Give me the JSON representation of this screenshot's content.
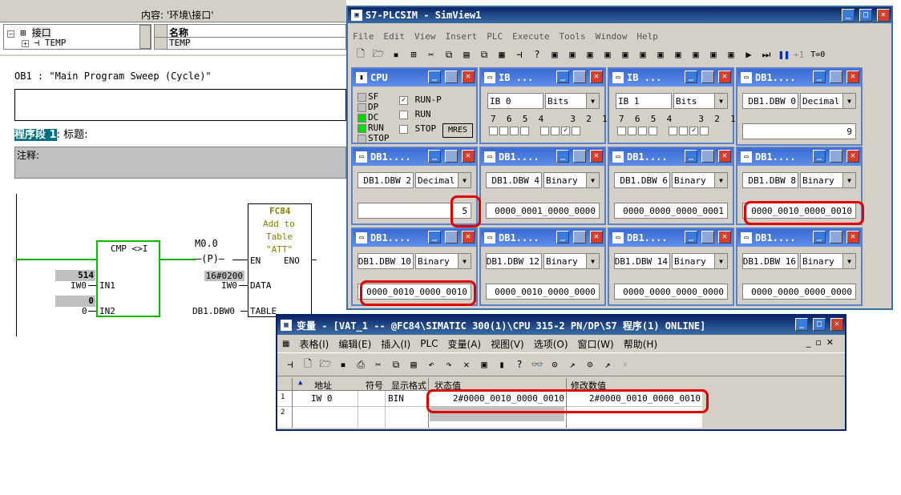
{
  "lad": {
    "content_label": "内容: '环境\\接口'",
    "tree_root": "接口",
    "tree_child": "TEMP",
    "name_header": "名称",
    "name_row": "TEMP",
    "block_title": "OB1 :  \"Main Program Sweep (Cycle)\"",
    "network_label": "程序段 1",
    "network_title": ": 标题:",
    "comment_label": "注释:",
    "cmp_title": "CMP <>I",
    "in1_value": "514",
    "in1_addr": "IW0",
    "in1_pin": "IN1",
    "in2_value": "0",
    "in2_addr": "0",
    "in2_pin": "IN2",
    "coil_addr": "M0.0",
    "coil_label": "P",
    "fc_name": "FC84",
    "fc_desc1": "Add to",
    "fc_desc2": "Table",
    "fc_desc3": "\"ATT\"",
    "en": "EN",
    "eno": "ENO",
    "data_value": "16#0200",
    "data_addr": "IW0",
    "data_pin": "DATA",
    "table_addr": "DB1.DBW0",
    "table_pin": "TABLE"
  },
  "plcsim": {
    "title": "S7-PLCSIM - SimView1",
    "menu": [
      "File",
      "Edit",
      "View",
      "Insert",
      "PLC",
      "Execute",
      "Tools",
      "Window",
      "Help"
    ],
    "step_label": "+1",
    "t_label": "T=0",
    "cpu": {
      "title": "CPU",
      "leds": [
        "SF",
        "DP",
        "DC",
        "RUN",
        "STOP"
      ],
      "modes": [
        "RUN-P",
        "RUN",
        "STOP"
      ],
      "mres": "MRES",
      "led_on": [
        "DC",
        "RUN"
      ]
    },
    "ib0": {
      "title": "IB ...",
      "addr": "IB    0",
      "fmt": "Bits",
      "bits": "7  6  5  4     3  2  1  0"
    },
    "ib1": {
      "title": "IB ...",
      "addr": "IB    1",
      "fmt": "Bits",
      "bits": "7  6  5  4     3  2  1  0"
    },
    "db_title": "DB1....",
    "db0": {
      "addr": "DB1.DBW    0",
      "fmt": "Decimal",
      "value": "9"
    },
    "db2": {
      "addr": "DB1.DBW    2",
      "fmt": "Decimal",
      "value": "5"
    },
    "db4": {
      "addr": "DB1.DBW    4",
      "fmt": "Binary",
      "value": "0000_0001_0000_0000"
    },
    "db6": {
      "addr": "DB1.DBW    6",
      "fmt": "Binary",
      "value": "0000_0000_0000_0001"
    },
    "db8": {
      "addr": "DB1.DBW    8",
      "fmt": "Binary",
      "value": "0000_0010_0000_0010"
    },
    "db10": {
      "addr": "DB1.DBW   10",
      "fmt": "Binary",
      "value": "0000_0010_0000_0010"
    },
    "db12": {
      "addr": "DB1.DBW   12",
      "fmt": "Binary",
      "value": "0000_0010_0000_0000"
    },
    "db14": {
      "addr": "DB1.DBW   14",
      "fmt": "Binary",
      "value": "0000_0000_0000_0000"
    },
    "db16": {
      "addr": "DB1.DBW   16",
      "fmt": "Binary",
      "value": "0000_0000_0000_0000"
    }
  },
  "vat": {
    "title": "变量 - [VAT_1 -- @FC84\\SIMATIC 300(1)\\CPU 315-2 PN/DP\\S7 程序(1)  ONLINE]",
    "menu": [
      "表格(I)",
      "编辑(E)",
      "插入(I)",
      "PLC",
      "变量(A)",
      "视图(V)",
      "选项(O)",
      "窗口(W)",
      "帮助(H)"
    ],
    "headers": [
      "地址",
      "符号",
      "显示格式",
      "状态值",
      "修改数值"
    ],
    "rows": [
      {
        "n": "1",
        "addr": "IW    0",
        "sym": "",
        "fmt": "BIN",
        "status": "2#0000_0010_0000_0010",
        "modify": "2#0000_0010_0000_0010"
      },
      {
        "n": "2",
        "addr": "",
        "sym": "",
        "fmt": "",
        "status": "",
        "modify": ""
      }
    ]
  },
  "colors": {
    "highlight": "#e00000",
    "run_led": "#00e000",
    "wire": "#00b000",
    "title_blue": "#0a246a"
  }
}
